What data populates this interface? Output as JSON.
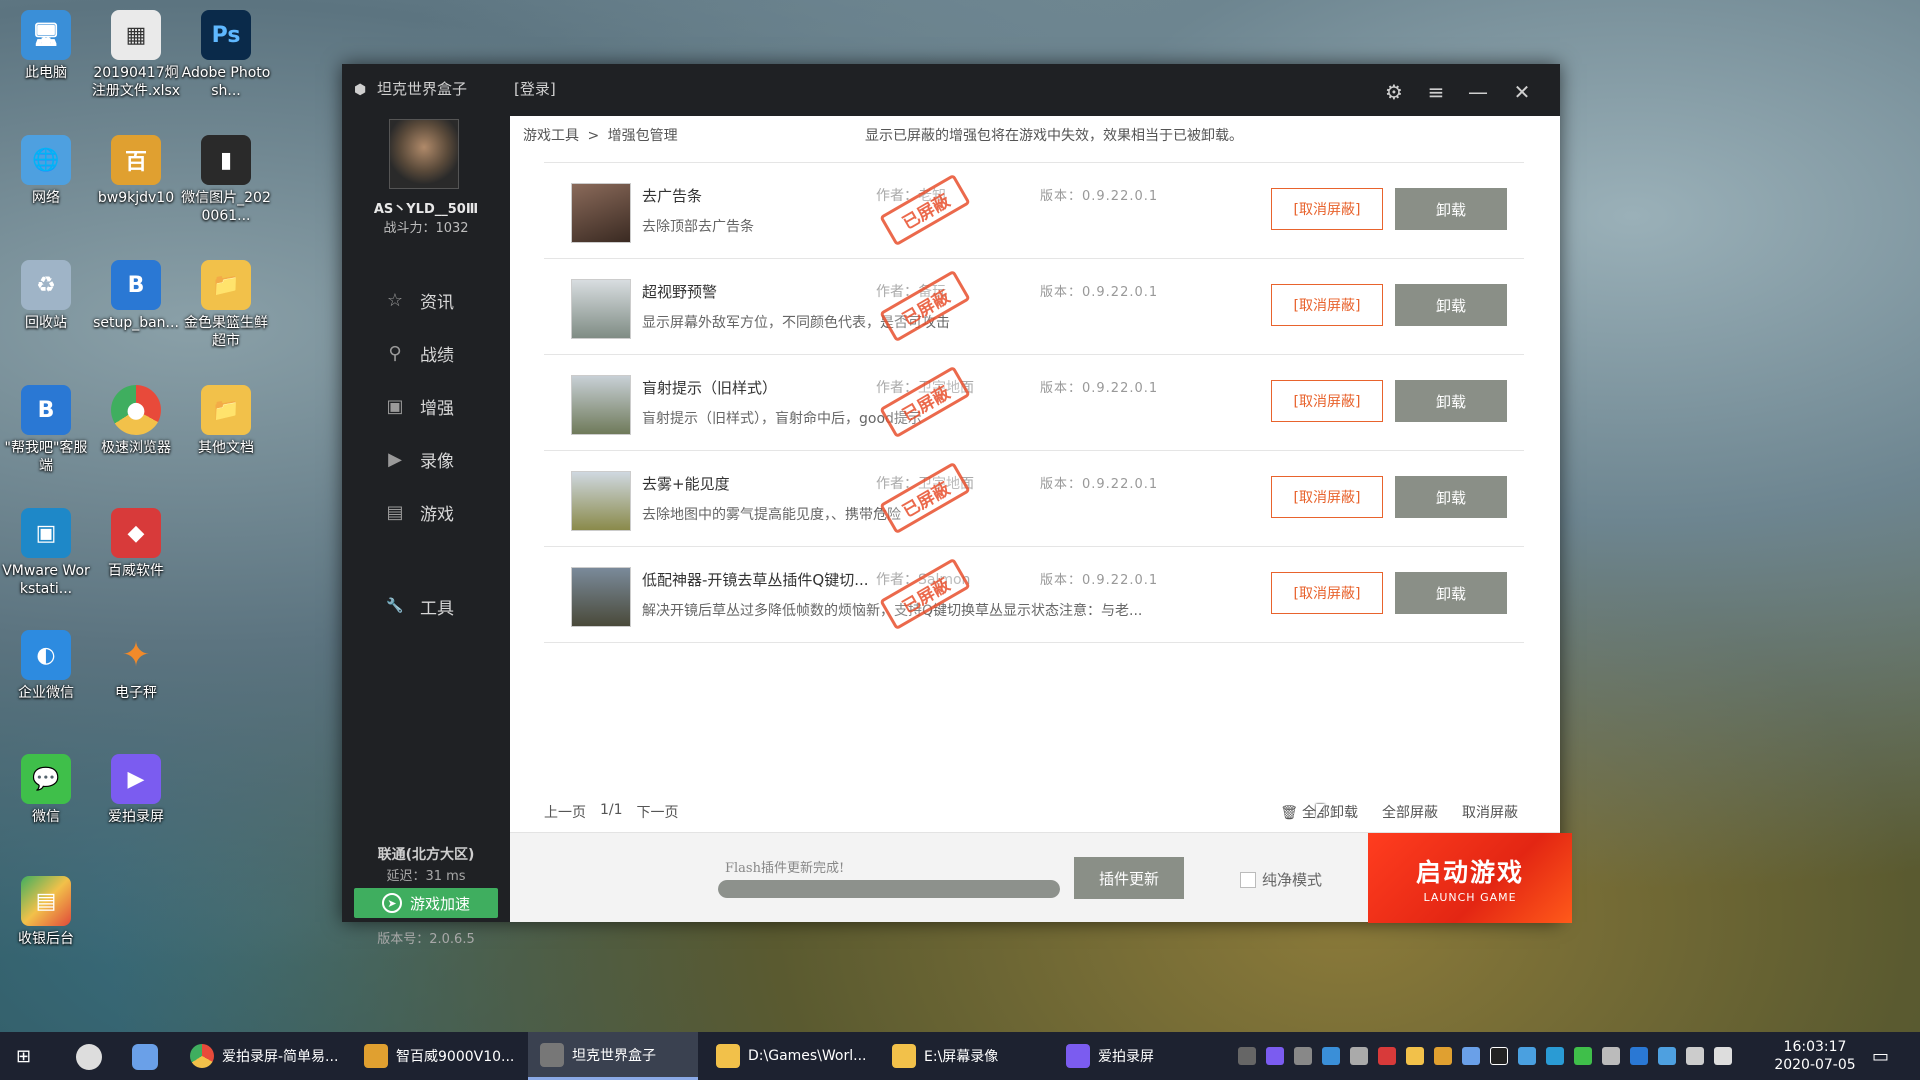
{
  "desktop": {
    "icons": [
      {
        "label": "此电脑"
      },
      {
        "label": "20190417炯注册文件.xlsx"
      },
      {
        "label": "Adobe Photosh..."
      },
      {
        "label": "网络"
      },
      {
        "label": "bw9kjdv10"
      },
      {
        "label": "微信图片_2020061..."
      },
      {
        "label": "回收站"
      },
      {
        "label": "setup_ban..."
      },
      {
        "label": "金色果篮生鲜超市"
      },
      {
        "label": "\"帮我吧\"客服端"
      },
      {
        "label": "极速浏览器"
      },
      {
        "label": "其他文档"
      },
      {
        "label": "VMware Workstati..."
      },
      {
        "label": "百威软件"
      },
      {
        "label": "企业微信"
      },
      {
        "label": "电子秤"
      },
      {
        "label": "微信"
      },
      {
        "label": "爱拍录屏"
      },
      {
        "label": "收银后台"
      }
    ]
  },
  "window": {
    "title": "坦克世界盒子",
    "login": "[登录]",
    "controls": {
      "settings": "⚙",
      "menu": "≡",
      "minimize": "—",
      "close": "✕"
    }
  },
  "sidebar": {
    "username": "AS丶YLD__50Ⅲ",
    "power": "战斗力：1032",
    "nav": [
      {
        "label": "资讯",
        "icon": "☆"
      },
      {
        "label": "战绩",
        "icon": "⚲"
      },
      {
        "label": "增强",
        "icon": "▣"
      },
      {
        "label": "录像",
        "icon": "▶"
      },
      {
        "label": "游戏",
        "icon": "▤"
      },
      {
        "label": "工具",
        "icon": "🔧"
      }
    ],
    "server": "联通(北方大区)",
    "latency": "延迟：31 ms",
    "accelerate": "游戏加速",
    "version": "版本号：2.0.6.5"
  },
  "content": {
    "breadcrumb": [
      "游戏工具",
      ">",
      "增强包管理"
    ],
    "hint": "显示已屏蔽的增强包将在游戏中失效，效果相当于已被卸载。",
    "stamp": "已屏蔽",
    "unblock_label": "[取消屏蔽]",
    "uninstall_label": "卸载",
    "packages": [
      {
        "name": "去广告条",
        "desc": "去除顶部去广告条",
        "author": "作者：老知",
        "version": "版本：0.9.22.0.1",
        "thumb": "#6a4a3a"
      },
      {
        "name": "超视野预警",
        "desc": "显示屏幕外敌军方位，不同颜色代表，是否可攻击",
        "author": "作者：备玩",
        "version": "版本：0.9.22.0.1",
        "thumb": "#9aa7a0"
      },
      {
        "name": "盲射提示（旧样式）",
        "desc": "盲射提示（旧样式），盲射命中后，good提示",
        "author": "作者：卫宇地面",
        "version": "版本：0.9.22.0.1",
        "thumb": "#7f8a6a"
      },
      {
        "name": "去雾+能见度",
        "desc": "去除地图中的雾气提高能见度，、携带危险",
        "author": "作者：卫宇地面",
        "version": "版本：0.9.22.0.1",
        "thumb": "#8d8a5a"
      },
      {
        "name": "低配神器-开镜去草丛插件Q键切...",
        "desc": "解决开镜后草丛过多降低帧数的烦恼新，支持Q键切换草丛显示状态注意：与老...",
        "author": "作者：Salmon",
        "version": "版本：0.9.22.0.1",
        "thumb": "#5a5a4a"
      }
    ],
    "pager": {
      "prev": "上一页",
      "page": "1/1",
      "next": "下一页"
    },
    "bulk": {
      "uninstall_all": "全部卸载",
      "block_all": "全部屏蔽",
      "unblock_all": "取消屏蔽"
    }
  },
  "footer": {
    "flash_msg": "Flash插件更新完成!",
    "progress": 1.0,
    "plugin_update": "插件更新",
    "pure_mode": "纯净模式",
    "launch_cn": "启动游戏",
    "launch_en": "LAUNCH GAME"
  },
  "taskbar": {
    "items": [
      {
        "label": "爱拍录屏-简单易...",
        "color": "#e04a3a"
      },
      {
        "label": "智百威9000V10...",
        "color": "#e0a030"
      },
      {
        "label": "坦克世界盒子",
        "color": "#777777"
      },
      {
        "label": "D:\\Games\\Worl...",
        "color": "#f2c14a"
      },
      {
        "label": "E:\\屏幕录像",
        "color": "#f2c14a"
      },
      {
        "label": "爱拍录屏",
        "color": "#7b5cf0"
      }
    ],
    "time": "16:03:17",
    "date": "2020-07-05"
  }
}
